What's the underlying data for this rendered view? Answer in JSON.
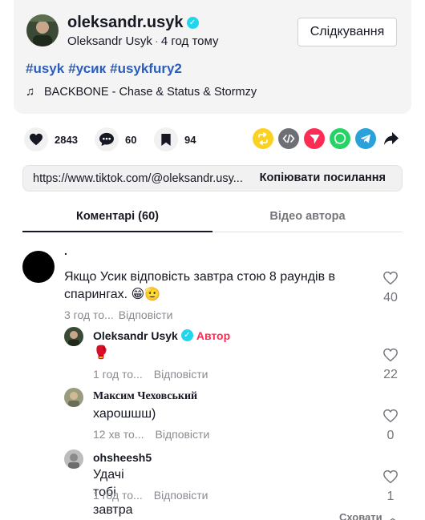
{
  "post": {
    "username": "oleksandr.usyk",
    "display_name": "Oleksandr Usyk",
    "time": "4 год тому",
    "follow_label": "Слідкування",
    "hashtags": [
      "#usyk",
      "#усик",
      "#usykfury2"
    ],
    "music": "BACKBONE - Chase & Status & Stormzy"
  },
  "actions": {
    "likes": "2843",
    "comments": "60",
    "saves": "94"
  },
  "share_colors": {
    "repost": "#fbd222",
    "embed": "#6e6f75",
    "send": "#fe2c55",
    "whatsapp": "#25d366",
    "telegram": "#2aa1da"
  },
  "link": {
    "url": "https://www.tiktok.com/@oleksandr.usyk/video/7451234567890",
    "url_visible": "https://www.tiktok.com/@oleksandr.usy...",
    "copy_label": "Копіювати посилання"
  },
  "tabs": {
    "comments": "Коментарі (60)",
    "author_videos": "Відео автора"
  },
  "comments": [
    {
      "name": ".",
      "text": "Якщо Усик відповість завтра стою 8 раундів в спарингах. 😁🫡",
      "time": "3 год то...",
      "reply": "Відповісти",
      "likes": "40"
    },
    {
      "name": "Oleksandr Usyk",
      "author_label": "Автор",
      "text": "🥊",
      "time": "1 год то...",
      "reply": "Відповісти",
      "likes": "22"
    },
    {
      "name": "Максим Чеховський",
      "text": "харошшш)",
      "time": "12 хв то...",
      "reply": "Відповісти",
      "likes": "0"
    },
    {
      "name": "ohsheesh5",
      "text": "Удачі тобі завтра дядя)",
      "time": "1 год то...",
      "reply": "Відповісти",
      "likes": "1"
    }
  ],
  "hide_label": "Сховати"
}
